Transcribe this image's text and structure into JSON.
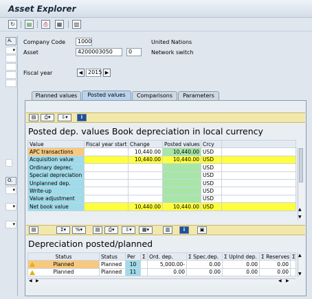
{
  "window": {
    "title": "Asset Explorer"
  },
  "toolbar": {
    "buttons": [
      {
        "name": "refresh-icon",
        "glyph": "↻"
      },
      {
        "name": "save-icon",
        "glyph": "▤"
      },
      {
        "name": "print-icon",
        "glyph": "⎙"
      },
      {
        "name": "layout-icon",
        "glyph": "▦"
      },
      {
        "name": "details-icon",
        "glyph": "▥"
      }
    ]
  },
  "left_pane": {
    "header1": "A.",
    "header2": "O."
  },
  "header": {
    "company_code_label": "Company Code",
    "company_code_value": "1000",
    "company_name": "United Nations",
    "asset_label": "Asset",
    "asset_value": "4200003050",
    "asset_sub_value": "0",
    "asset_desc": "Network switch",
    "fiscal_year_label": "Fiscal year",
    "fiscal_year_value": "2015"
  },
  "tabs": [
    {
      "label": "Planned values",
      "active": false
    },
    {
      "label": "Posted values",
      "active": true
    },
    {
      "label": "Comparisons",
      "active": false
    },
    {
      "label": "Parameters",
      "active": false
    }
  ],
  "posted": {
    "title": "Posted dep. values Book depreciation in local currency",
    "columns": [
      "Value",
      "Fiscal year start",
      "Change",
      "Posted values",
      "Crcy"
    ],
    "rows": [
      {
        "label": "APC transactions",
        "start": "",
        "change": "10,440.00",
        "posted": "10,440.00",
        "crcy": "USD"
      },
      {
        "label": "Acquisition value",
        "start": "",
        "change": "10,440.00",
        "posted": "10,440.00",
        "crcy": "USD"
      },
      {
        "label": "Ordinary deprec.",
        "start": "",
        "change": "",
        "posted": "",
        "crcy": "USD"
      },
      {
        "label": "Special depreciation",
        "start": "",
        "change": "",
        "posted": "",
        "crcy": "USD"
      },
      {
        "label": "Unplanned dep.",
        "start": "",
        "change": "",
        "posted": "",
        "crcy": "USD"
      },
      {
        "label": "Write-up",
        "start": "",
        "change": "",
        "posted": "",
        "crcy": "USD"
      },
      {
        "label": "Value adjustment",
        "start": "",
        "change": "",
        "posted": "",
        "crcy": "USD"
      },
      {
        "label": "Net book value",
        "start": "",
        "change": "10,440.00",
        "posted": "10,440.00",
        "crcy": "USD"
      }
    ]
  },
  "depreciation": {
    "title": "Depreciation posted/planned",
    "columns": [
      "Status",
      "Status",
      "Per",
      "Σ",
      "Ord. dep.",
      "Σ Spec.dep.",
      "Σ Uplnd dep.",
      "Σ Reserves",
      "Σ"
    ],
    "rows": [
      {
        "status_text": "Planned",
        "status2": "Planned",
        "per": "10",
        "ord_dep": "5,000.00-",
        "spec_dep": "0.00",
        "uplnd_dep": "0.00",
        "reserves": "0.00"
      },
      {
        "status_text": "Planned",
        "status2": "Planned",
        "per": "11",
        "ord_dep": "0.00",
        "spec_dep": "0.00",
        "uplnd_dep": "0.00",
        "reserves": "0.00"
      }
    ]
  }
}
